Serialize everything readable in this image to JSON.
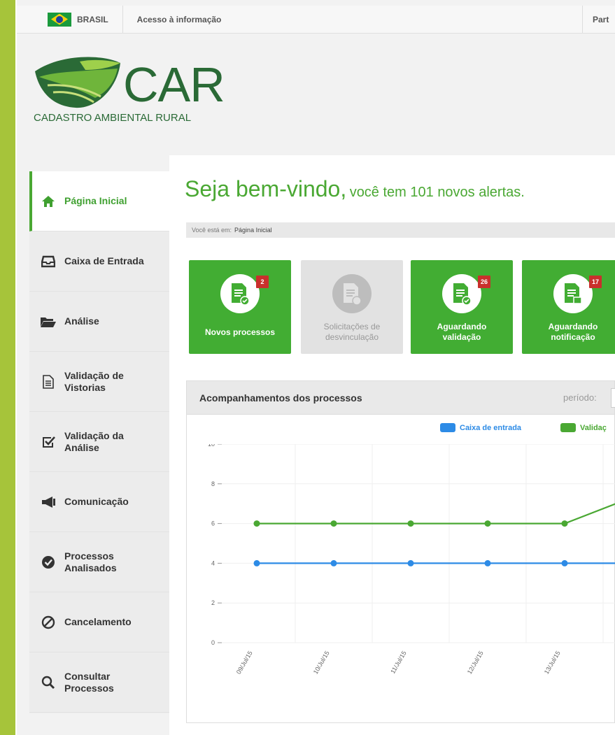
{
  "topbar": {
    "brasil": "BRASIL",
    "acesso": "Acesso à informação",
    "partial": "Part"
  },
  "logo": {
    "title": "CAR",
    "subtitle": "CADASTRO AMBIENTAL RURAL"
  },
  "sidebar": {
    "items": [
      {
        "label": "Página Inicial",
        "icon": "home-icon",
        "active": true
      },
      {
        "label": "Caixa de Entrada",
        "icon": "inbox-icon"
      },
      {
        "label": "Análise",
        "icon": "folder-open-icon"
      },
      {
        "label": "Validação de Vistorias",
        "icon": "document-icon"
      },
      {
        "label": "Validação da Análise",
        "icon": "check-square-icon"
      },
      {
        "label": "Comunicação",
        "icon": "megaphone-icon"
      },
      {
        "label": "Processos Analisados",
        "icon": "check-circle-icon"
      },
      {
        "label": "Cancelamento",
        "icon": "ban-icon"
      },
      {
        "label": "Consultar Processos",
        "icon": "search-icon"
      }
    ]
  },
  "welcome": {
    "big": "Seja bem-vindo,",
    "small": "você tem 101 novos alertas."
  },
  "breadcrumb": {
    "prefix": "Você está em:",
    "current": "Página Inicial"
  },
  "tiles": [
    {
      "label": "Novos processos",
      "badge": "2",
      "disabled": false
    },
    {
      "label": "Solicitações de desvinculação",
      "badge": "",
      "disabled": true
    },
    {
      "label": "Aguardando validação",
      "badge": "26",
      "disabled": false
    },
    {
      "label": "Aguardando notificação",
      "badge": "17",
      "disabled": false
    }
  ],
  "panel": {
    "title": "Acompanhamentos dos processos",
    "periodo": "período:"
  },
  "colors": {
    "green": "#4aa833",
    "blue": "#2d8be6",
    "badge": "#c9302c"
  },
  "chart_data": {
    "type": "line",
    "categories": [
      "09/Jul/15",
      "10/Jul/15",
      "11/Jul/15",
      "12/Jul/15",
      "13/Jul/15"
    ],
    "series": [
      {
        "name": "Caixa de entrada",
        "values": [
          4,
          4,
          4,
          4,
          4,
          4
        ],
        "color": "#2d8be6"
      },
      {
        "name": "Validaç",
        "values": [
          6,
          6,
          6,
          6,
          6,
          7.5
        ],
        "color": "#4aa833"
      }
    ],
    "y_ticks": [
      "0",
      "2",
      "4",
      "6",
      "8",
      "10"
    ],
    "ylim": [
      0,
      10
    ],
    "grid": true,
    "legend": "top"
  }
}
